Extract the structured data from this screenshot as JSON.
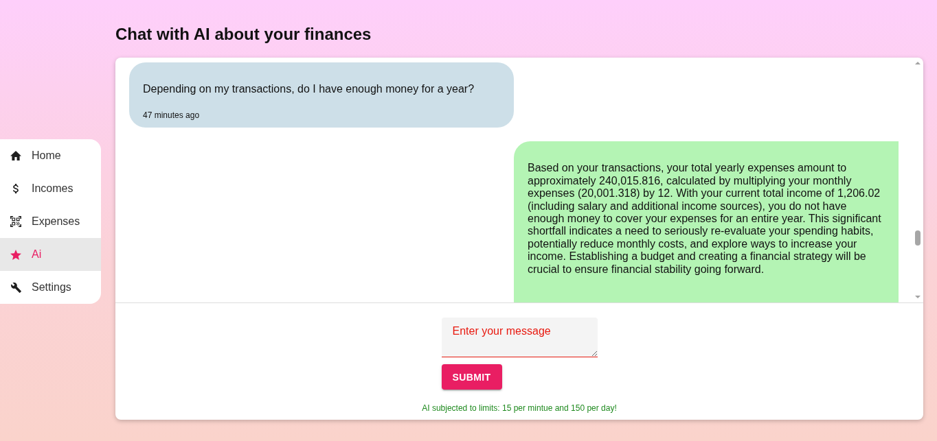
{
  "page": {
    "title": "Chat with AI about your finances"
  },
  "sidebar": {
    "items": [
      {
        "label": "Home",
        "selected": false
      },
      {
        "label": "Incomes",
        "selected": false
      },
      {
        "label": "Expenses",
        "selected": false
      },
      {
        "label": "Ai",
        "selected": true
      },
      {
        "label": "Settings",
        "selected": false
      }
    ]
  },
  "chat": {
    "messages": [
      {
        "kind": "user",
        "text": "Depending on my transactions, do I have enough money for a year?",
        "time": "47 minutes ago"
      },
      {
        "kind": "assistant",
        "text": "Based on your transactions, your total yearly expenses amount to approximately 240,015.816, calculated by multiplying your monthly expenses (20,001.318) by 12. With your current total income of 1,206.02 (including salary and additional income sources), you do not have enough money to cover your expenses for an entire year. This significant shortfall indicates a need to seriously re-evaluate your spending habits, potentially reduce monthly costs, and explore ways to increase your income. Establishing a budget and creating a financial strategy will be crucial to ensure financial stability going forward."
      }
    ]
  },
  "composer": {
    "message_field": {
      "placeholder": "Enter your message"
    },
    "submit_button": "SUBMIT",
    "limits_note": "AI subjected to limits: 15 per mintue and 150 per day!"
  }
}
